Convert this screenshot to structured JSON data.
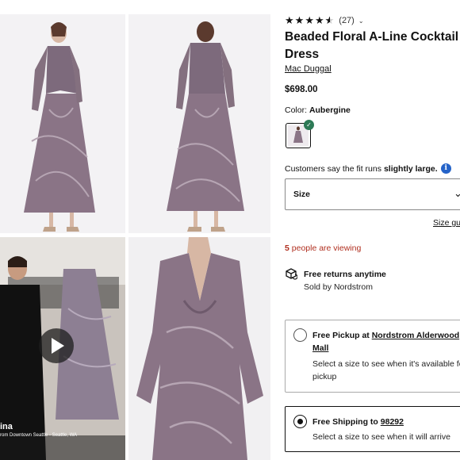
{
  "product": {
    "rating_count": "(27)",
    "rating_value": 4.5,
    "title": "Beaded Floral A-Line Cocktail Dress",
    "brand": "Mac Duggal",
    "price": "$698.00",
    "color_label": "Color:",
    "color_value": "Aubergine"
  },
  "fit": {
    "prefix": "Customers say the fit runs",
    "emphasis": "slightly large."
  },
  "size": {
    "label": "Size",
    "guide_label": "Size guide"
  },
  "viewing": {
    "count": "5",
    "text": "people are viewing"
  },
  "returns": {
    "title": "Free returns anytime",
    "sold_by": "Sold by Nordstrom"
  },
  "pickup": {
    "title_prefix": "Free Pickup at",
    "store": "Nordstrom Alderwood Mall",
    "text": "Select a size to see when it's available for pickup"
  },
  "shipping": {
    "title_prefix": "Free Shipping to",
    "zip": "98292",
    "text": "Select a size to see when it will arrive"
  },
  "video": {
    "name": "ina",
    "location": "rom Downtown Seattle - Seattle, WA"
  },
  "icons": {
    "star": "star-icon",
    "chevron": "chevron-down-icon",
    "info": "info-icon",
    "returns": "returns-box-icon",
    "play": "play-icon",
    "check": "check-icon"
  },
  "colors": {
    "viewing_red": "#b02f1f",
    "info_blue": "#2563c8",
    "check_green": "#2d7a56",
    "dress_purple": "#8a7486"
  }
}
